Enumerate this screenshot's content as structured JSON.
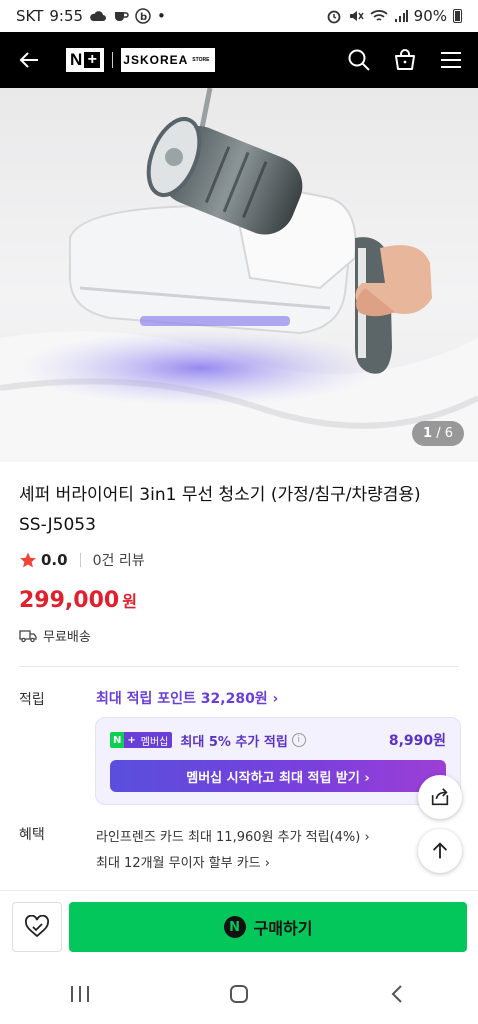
{
  "status_bar": {
    "carrier": "SKT",
    "time": "9:55",
    "dot": "•",
    "battery": "90%"
  },
  "header": {
    "logo_n": "N",
    "logo_plus": "+",
    "store": "JSKOREA",
    "store_small": "STORE",
    "icons": [
      "back-arrow-icon",
      "search-icon",
      "shopping-bag-icon",
      "menu-icon"
    ]
  },
  "hero": {
    "counter_current": "1",
    "counter_sep": " / ",
    "counter_total": "6"
  },
  "product": {
    "title_line1": "셰퍼 버라이어티 3in1 무선 청소기 (가정/침구/차량겸용)",
    "title_line2": "SS-J5053",
    "rating": "0.0",
    "reviews": "0건 리뷰",
    "price": "299,000",
    "currency": "원",
    "shipping": "무료배송"
  },
  "points": {
    "label": "적립",
    "link": "최대 적립 포인트 32,280원 ›",
    "membership": {
      "badge_n": "N",
      "badge_plus": "+",
      "badge_text": "멤버십",
      "extra": "최대 5% 추가 적립",
      "info": "i",
      "amount": "8,990원",
      "button": "멤버십 시작하고 최대 적립 받기 ›"
    }
  },
  "benefits": {
    "label": "혜택",
    "line1": "라인프렌즈 카드 최대 11,960원 추가 적립(4%) ›",
    "line2": "최대 12개월 무이자 할부 카드 ›"
  },
  "buy_bar": {
    "n_logo": "N",
    "buy_label": "구매하기"
  },
  "colors": {
    "brand_green": "#03c75a",
    "price_red": "#e0202c",
    "accent_purple": "#6a3fd8"
  }
}
